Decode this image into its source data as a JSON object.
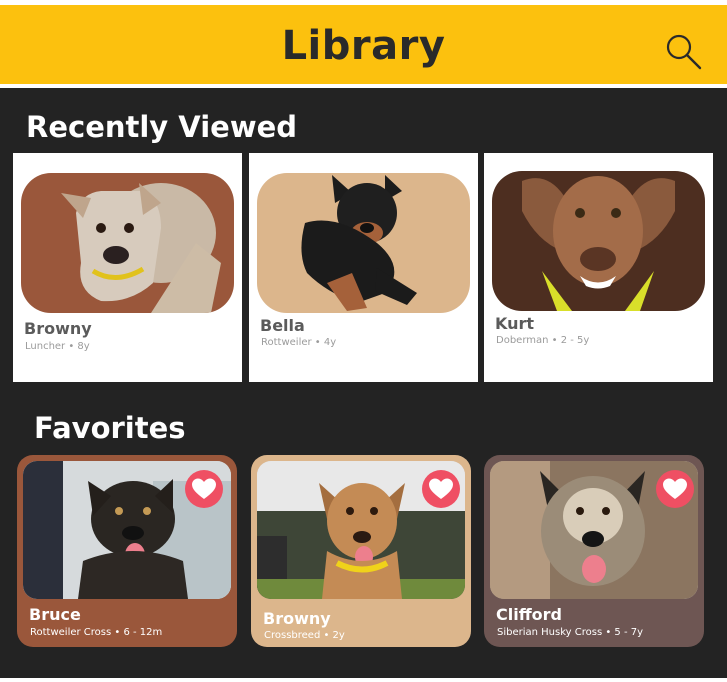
{
  "header": {
    "title": "Library",
    "search_icon": "search-icon"
  },
  "recent": {
    "title": "Recently Viewed",
    "items": [
      {
        "name": "Browny",
        "subtitle": "Luncher • 8y",
        "photo_bg": "#9a573b"
      },
      {
        "name": "Bella",
        "subtitle": "Rottweiler • 4y",
        "photo_bg": "#dcb68c"
      },
      {
        "name": "Kurt",
        "subtitle": "Doberman • 2 - 5y",
        "photo_bg": "#4d2e20"
      }
    ]
  },
  "favorites": {
    "title": "Favorites",
    "items": [
      {
        "name": "Bruce",
        "subtitle": "Rottweiler Cross • 6 - 12m",
        "card_bg": "#9a573b"
      },
      {
        "name": "Browny",
        "subtitle": "Crossbreed • 2y",
        "card_bg": "#dcb68c"
      },
      {
        "name": "Clifford",
        "subtitle": "Siberian Husky Cross • 5 - 7y",
        "card_bg": "#6e5653"
      }
    ]
  },
  "colors": {
    "header": "#fcc10e",
    "background": "#232323",
    "heart": "#ef4f63"
  }
}
